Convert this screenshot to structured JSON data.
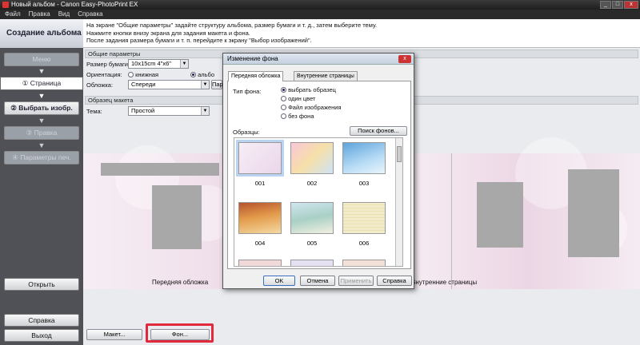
{
  "window": {
    "title": "Новый альбом - Canon Easy-PhotoPrint EX",
    "controls": [
      "_",
      "□",
      "x"
    ]
  },
  "menu": [
    "Файл",
    "Правка",
    "Вид",
    "Справка"
  ],
  "sidebar": {
    "title": "Создание альбома",
    "steps": [
      {
        "label": "Меню"
      },
      {
        "label": "① Страница"
      },
      {
        "label": "② Выбрать изобр."
      },
      {
        "label": "③ Правка"
      },
      {
        "label": "④ Параметры печ."
      }
    ],
    "open_label": "Открыть",
    "help_label": "Справка",
    "exit_label": "Выход"
  },
  "info": {
    "line1": "На экране \"Общие параметры\" задайте структуру альбома, размер бумаги и т. д., затем выберите тему.",
    "line2": "Нажмите кнопки внизу экрана для задания макета и фона.",
    "line3": "После задания размера бумаги и т. п. перейдите к экрану \"Выбор изображений\"."
  },
  "general": {
    "section_title": "Общие параметры",
    "paper_label": "Размер бумаги:",
    "paper_value": "10x15cm 4\"x6\"",
    "orientation_label": "Ориентация:",
    "orientation_portrait": "книжная",
    "orientation_album": "альбо",
    "cover_label": "Обложка:",
    "cover_value": "Спереди",
    "cover_button": "Пар"
  },
  "layout_sample": {
    "section_title": "Образец макета",
    "theme_label": "Тема:",
    "theme_value": "Простой",
    "front_caption": "Передняя обложка",
    "inner_caption": "Внутренние страницы"
  },
  "bottom": {
    "layout_button": "Макет...",
    "background_button": "Фон..."
  },
  "dialog": {
    "title": "Изменение фона",
    "tabs": [
      "Передняя обложка",
      "Внутренние страницы"
    ],
    "bg_type_label": "Тип фона:",
    "bg_options": [
      "выбрать образец",
      "один цвет",
      "Файл изображения",
      "без фона"
    ],
    "samples_label": "Образцы:",
    "search_button": "Поиск фонов...",
    "thumbnails": [
      "001",
      "002",
      "003",
      "004",
      "005",
      "006"
    ],
    "ok": "OK",
    "cancel": "Отмена",
    "apply": "Применить",
    "help": "Справка"
  },
  "colors": {
    "highlight": "#e0293d",
    "accent": "#3a6ec0"
  }
}
